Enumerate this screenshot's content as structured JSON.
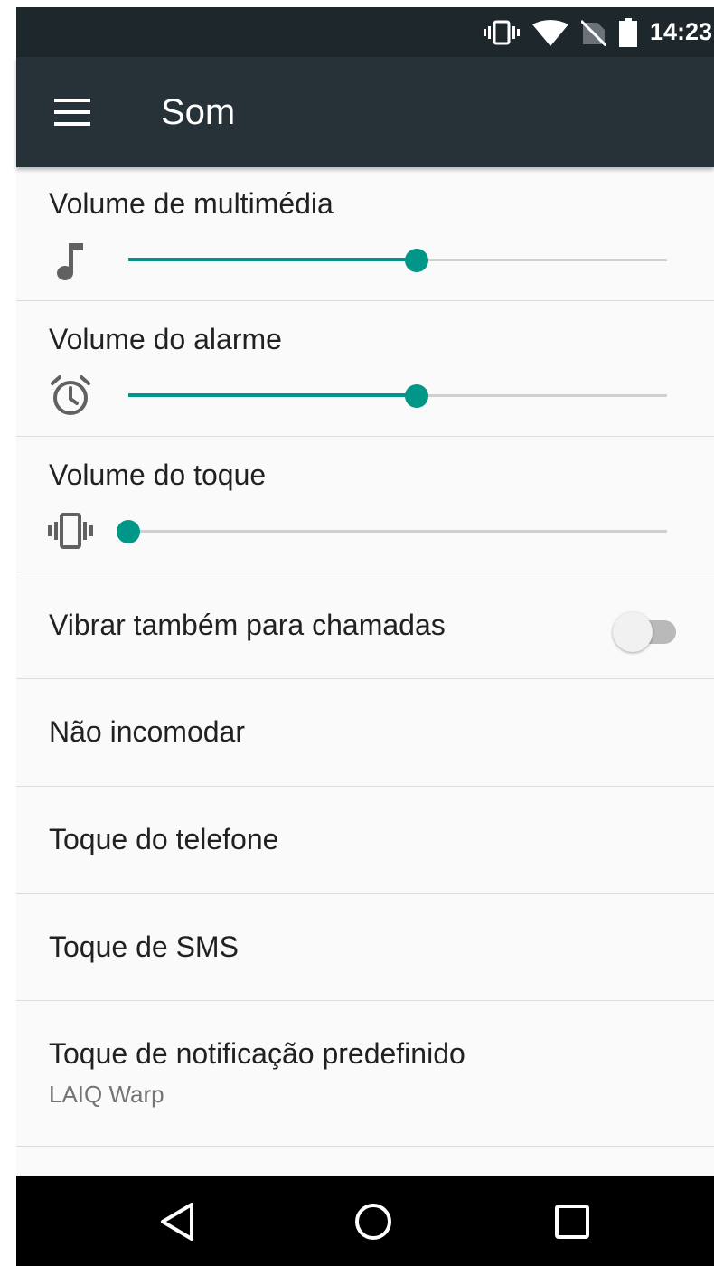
{
  "status_bar": {
    "time": "14:23",
    "icons": [
      "vibrate-icon",
      "wifi-icon",
      "no-sim-icon",
      "battery-icon"
    ]
  },
  "toolbar": {
    "title": "Som",
    "menu_icon": "menu-icon"
  },
  "volumes": [
    {
      "label": "Volume de multimédia",
      "icon": "music-note-icon",
      "level": 0.535
    },
    {
      "label": "Volume do alarme",
      "icon": "alarm-icon",
      "level": 0.535
    },
    {
      "label": "Volume do toque",
      "icon": "vibrate-icon",
      "level": 0.0
    }
  ],
  "vibrate_calls": {
    "label": "Vibrar também para chamadas",
    "enabled": false
  },
  "items": [
    {
      "label": "Não incomodar"
    },
    {
      "label": "Toque do telefone"
    },
    {
      "label": "Toque de SMS"
    },
    {
      "label": "Toque de notificação predefinido",
      "summary": "LAIQ Warp"
    }
  ],
  "nav_bar": {
    "icons": [
      "back-icon",
      "home-icon",
      "recents-icon"
    ]
  },
  "colors": {
    "accent": "#009688",
    "toolbar": "#263238",
    "status_bar": "#1e272c"
  }
}
